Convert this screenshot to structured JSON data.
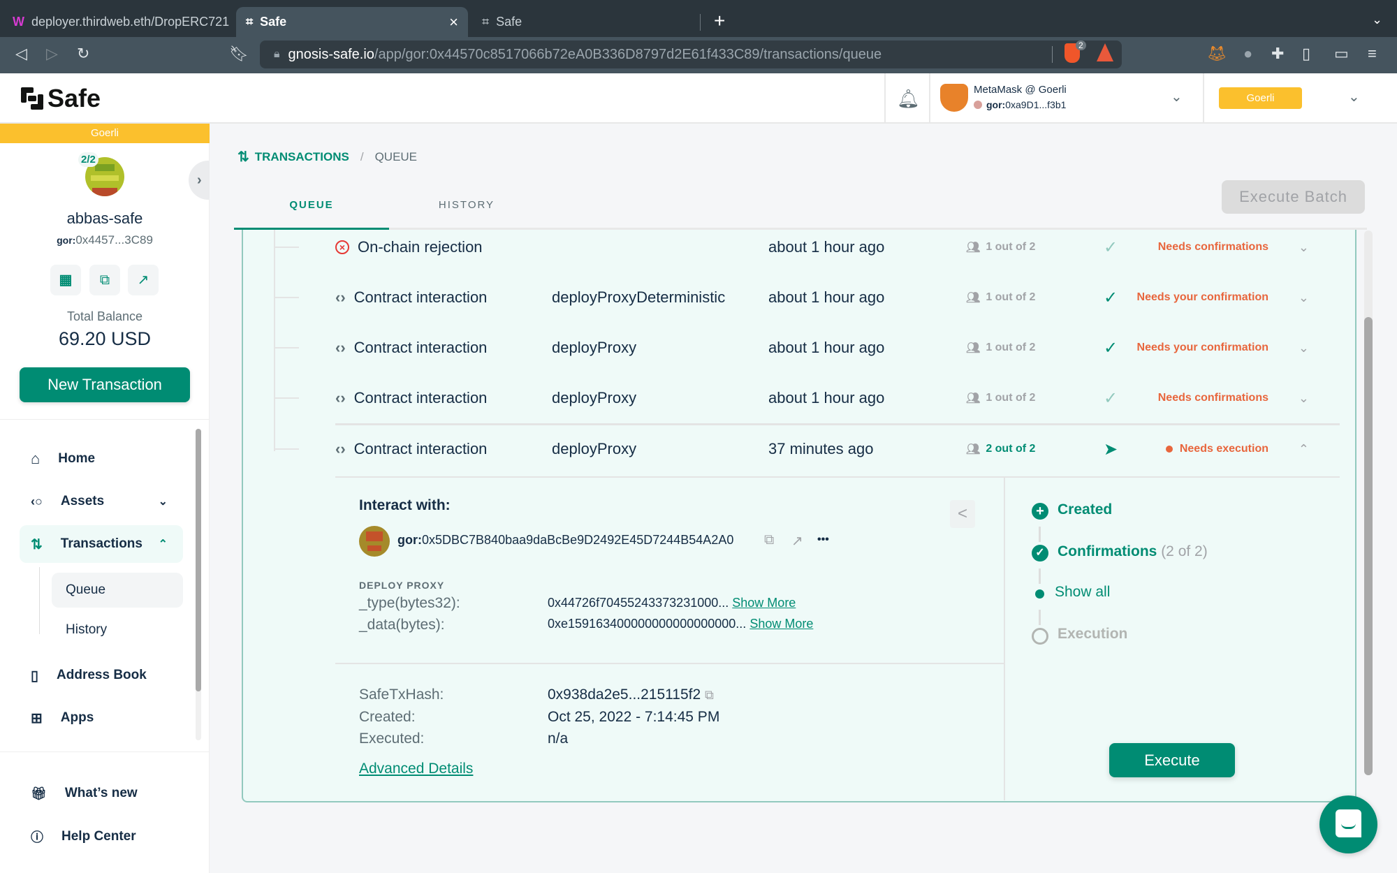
{
  "browser": {
    "tabs": [
      {
        "label": "deployer.thirdweb.eth/DropERC721",
        "active": false,
        "icon": "thirdweb-icon"
      },
      {
        "label": "Safe",
        "active": true,
        "icon": "safe-icon"
      },
      {
        "label": "Safe",
        "active": false,
        "icon": "safe-icon"
      }
    ],
    "close_glyph": "×",
    "new_tab_glyph": "+",
    "url_host": "gnosis-safe.io",
    "url_path": "/app/gor:0x44570c8517066b72eA0B336D8797d2E61f433C89/transactions/queue",
    "brave_badge": "2"
  },
  "header": {
    "logo_text": "Safe",
    "wallet_name": "MetaMask @ Goerli",
    "wallet_prefix": "gor:",
    "wallet_address": "0xa9D1...f3b1",
    "network": "Goerli",
    "network_color": "#fbc02d"
  },
  "sidebar": {
    "network_banner": "Goerli",
    "threshold": "2/2",
    "safe_name": "abbas-safe",
    "safe_prefix": "gor:",
    "safe_address": "0x4457...3C89",
    "balance_label": "Total Balance",
    "balance": "69.20 USD",
    "new_tx_label": "New Transaction",
    "nav": [
      {
        "label": "Home",
        "icon": "home-icon"
      },
      {
        "label": "Assets",
        "icon": "assets-icon"
      },
      {
        "label": "Transactions",
        "icon": "transactions-icon",
        "active": true
      },
      {
        "label": "Address Book",
        "icon": "address-book-icon"
      },
      {
        "label": "Apps",
        "icon": "apps-icon"
      }
    ],
    "sub_nav": [
      {
        "label": "Queue",
        "active": true
      },
      {
        "label": "History"
      }
    ],
    "footer": [
      {
        "label": "What’s new",
        "icon": "gift-icon"
      },
      {
        "label": "Help Center",
        "icon": "help-icon"
      }
    ]
  },
  "main": {
    "breadcrumb_root": "TRANSACTIONS",
    "breadcrumb_sep": "/",
    "breadcrumb_current": "QUEUE",
    "tabs": [
      {
        "label": "QUEUE",
        "active": true
      },
      {
        "label": "HISTORY"
      }
    ],
    "execute_batch_label": "Execute Batch",
    "accent": "#008c73",
    "warning": "#e8663d",
    "rows": [
      {
        "type": "On-chain rejection",
        "method": "",
        "time": "about 1 hour ago",
        "confirmations": "1 out of 2",
        "status": "Needs confirmations",
        "check": "light"
      },
      {
        "type": "Contract interaction",
        "method": "deployProxyDeterministic",
        "time": "about 1 hour ago",
        "confirmations": "1 out of 2",
        "status": "Needs your confirmation",
        "check": "dark"
      },
      {
        "type": "Contract interaction",
        "method": "deployProxy",
        "time": "about 1 hour ago",
        "confirmations": "1 out of 2",
        "status": "Needs your confirmation",
        "check": "dark"
      },
      {
        "type": "Contract interaction",
        "method": "deployProxy",
        "time": "about 1 hour ago",
        "confirmations": "1 out of 2",
        "status": "Needs confirmations",
        "check": "light"
      },
      {
        "type": "Contract interaction",
        "method": "deployProxy",
        "time": "37 minutes ago",
        "confirmations": "2 out of 2",
        "status": "Needs execution",
        "check": "send"
      }
    ],
    "details": {
      "interact_label": "Interact with:",
      "address_prefix": "gor:",
      "address": "0x5DBC7B840baa9daBcBe9D2492E45D7244B54A2A0",
      "more_glyph": "•••",
      "method_title": "DEPLOY PROXY",
      "params": [
        {
          "name": "_type(bytes32):",
          "value": "0x44726f70455243373231000...",
          "link": "Show More"
        },
        {
          "name": "_data(bytes):",
          "value": "0xe159163400000000000000000...",
          "link": "Show More"
        }
      ],
      "safe_tx_hash_label": "SafeTxHash:",
      "safe_tx_hash": "0x938da2e5...215115f2",
      "created_label": "Created:",
      "created": "Oct 25, 2022 - 7:14:45 PM",
      "executed_label": "Executed:",
      "executed": "n/a",
      "advanced_label": "Advanced Details"
    },
    "timeline": {
      "created": "Created",
      "confirmations": "Confirmations",
      "confirmations_count": "(2 of 2)",
      "show_all": "Show all",
      "execution": "Execution",
      "execute_label": "Execute"
    }
  }
}
